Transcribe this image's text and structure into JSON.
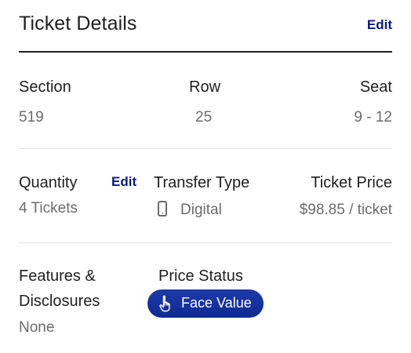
{
  "header": {
    "title": "Ticket Details",
    "edit_label": "Edit"
  },
  "seating": {
    "section_label": "Section",
    "section_value": "519",
    "row_label": "Row",
    "row_value": "25",
    "seat_label": "Seat",
    "seat_value": "9 - 12"
  },
  "purchase": {
    "quantity_label": "Quantity",
    "quantity_edit_label": "Edit",
    "quantity_value": "4 Tickets",
    "transfer_label": "Transfer Type",
    "transfer_icon": "mobile-phone-icon",
    "transfer_value": "Digital",
    "price_label": "Ticket Price",
    "price_value": "$98.85 / ticket"
  },
  "features": {
    "label_line1": "Features &",
    "label_line2": "Disclosures",
    "value": "None"
  },
  "price_status": {
    "label": "Price Status",
    "badge_icon": "hand-pointing-up-icon",
    "badge_label": "Face Value",
    "badge_color": "#1a35a0"
  },
  "colors": {
    "accent": "#0b1a8a",
    "text_primary": "#1f1f1f",
    "text_secondary": "#6c6c6c",
    "divider": "#e4e4e4"
  }
}
